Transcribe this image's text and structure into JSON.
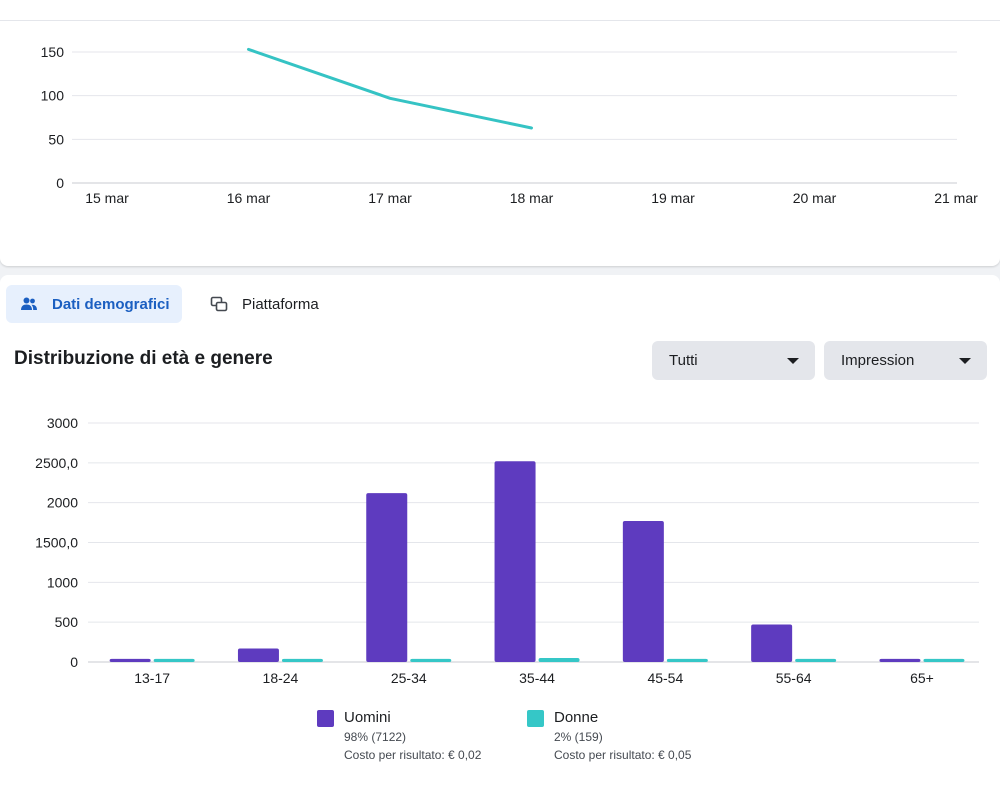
{
  "top_chart": {
    "x_labels": [
      "15 mar",
      "16 mar",
      "17 mar",
      "18 mar",
      "19 mar",
      "20 mar",
      "21 mar"
    ],
    "y_ticks": [
      "0",
      "50",
      "100",
      "150"
    ],
    "line_color": "#35c3c4"
  },
  "tabs": [
    {
      "label": "Dati demografici",
      "icon": "people-icon",
      "active": true
    },
    {
      "label": "Piattaforma",
      "icon": "platform-icon",
      "active": false
    }
  ],
  "section_title": "Distribuzione di età e genere",
  "filters": {
    "audience": "Tutti",
    "metric": "Impression"
  },
  "colors": {
    "men": "#5e3bbf",
    "women": "#35c7c7",
    "active_tab": "#1b5fc1"
  },
  "legend": [
    {
      "name": "Uomini",
      "share": "98% (7122)",
      "cost": "Costo per risultato: € 0,02"
    },
    {
      "name": "Donne",
      "share": "2% (159)",
      "cost": "Costo per risultato: € 0,05"
    }
  ],
  "chart_data": [
    {
      "type": "line",
      "x": [
        "15 mar",
        "16 mar",
        "17 mar",
        "18 mar",
        "19 mar",
        "20 mar",
        "21 mar"
      ],
      "series": [
        {
          "values": [
            null,
            153,
            97,
            63,
            null,
            null,
            null
          ]
        }
      ],
      "ylim": [
        0,
        150
      ],
      "y_ticks": [
        0,
        50,
        100,
        150
      ],
      "grid": true
    },
    {
      "type": "bar",
      "title": "Distribuzione di età e genere",
      "categories": [
        "13-17",
        "18-24",
        "25-34",
        "35-44",
        "45-54",
        "55-64",
        "65+"
      ],
      "series": [
        {
          "name": "Uomini",
          "values": [
            40,
            170,
            2120,
            2520,
            1770,
            470,
            40
          ]
        },
        {
          "name": "Donne",
          "values": [
            40,
            40,
            40,
            50,
            40,
            40,
            40
          ]
        }
      ],
      "ylim": [
        0,
        3000
      ],
      "y_ticks": [
        "0",
        "500",
        "1000",
        "1500,0",
        "2000",
        "2500,0",
        "3000"
      ],
      "grid": true,
      "legend": "bottom"
    }
  ]
}
